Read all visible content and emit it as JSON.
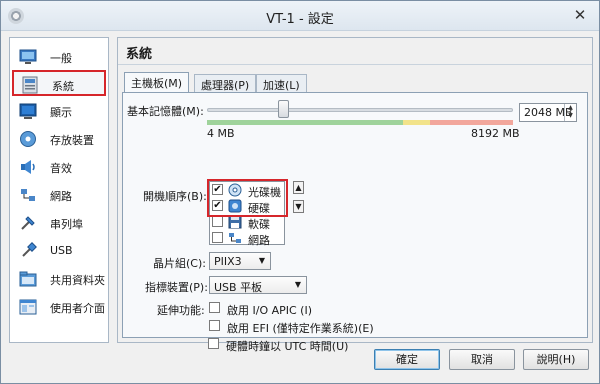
{
  "window": {
    "title": "VT-1 - 設定"
  },
  "sidebar": {
    "items": [
      {
        "label": "一般",
        "icon": "general-icon"
      },
      {
        "label": "系統",
        "icon": "system-icon",
        "selected": true
      },
      {
        "label": "顯示",
        "icon": "display-icon"
      },
      {
        "label": "存放裝置",
        "icon": "storage-icon"
      },
      {
        "label": "音效",
        "icon": "audio-icon"
      },
      {
        "label": "網路",
        "icon": "network-icon"
      },
      {
        "label": "串列埠",
        "icon": "serial-port-icon"
      },
      {
        "label": "USB",
        "icon": "usb-icon"
      },
      {
        "label": "共用資料夾",
        "icon": "shared-folder-icon"
      },
      {
        "label": "使用者介面",
        "icon": "user-interface-icon"
      }
    ]
  },
  "main": {
    "title": "系統",
    "tabs": [
      {
        "label": "主機板(M)",
        "active": true
      },
      {
        "label": "處理器(P)"
      },
      {
        "label": "加速(L)"
      }
    ],
    "memory": {
      "label": "基本記憶體(M):",
      "value": "2048 MB",
      "min_label": "4 MB",
      "max_label": "8192 MB",
      "fraction": 0.25
    },
    "boot": {
      "label": "開機順序(B):",
      "items": [
        {
          "label": "光碟機",
          "checked": true,
          "icon": "optical-disc-icon"
        },
        {
          "label": "硬碟",
          "checked": true,
          "icon": "hard-disk-icon"
        },
        {
          "label": "軟碟",
          "checked": false,
          "icon": "floppy-icon"
        },
        {
          "label": "網路",
          "checked": false,
          "icon": "network-boot-icon"
        }
      ],
      "up_glyph": "▲",
      "down_glyph": "▼"
    },
    "chipset": {
      "label": "晶片組(C):",
      "value": "PIIX3"
    },
    "pointing": {
      "label": "指標裝置(P):",
      "value": "USB 平板"
    },
    "extended": {
      "label": "延伸功能:",
      "options": [
        {
          "label": "啟用 I/O APIC (I)",
          "checked": false
        },
        {
          "label": "啟用 EFI (僅特定作業系統)(E)",
          "checked": false
        },
        {
          "label": "硬體時鐘以 UTC 時間(U)",
          "checked": false
        }
      ]
    }
  },
  "buttons": {
    "ok": "確定",
    "cancel": "取消",
    "help": "說明(H)"
  },
  "glyphs": {
    "check": "✔",
    "close": "✕",
    "dropdown": "▼"
  },
  "colors": {
    "highlight": "#d6262b",
    "accent": "#3c7fb1"
  }
}
